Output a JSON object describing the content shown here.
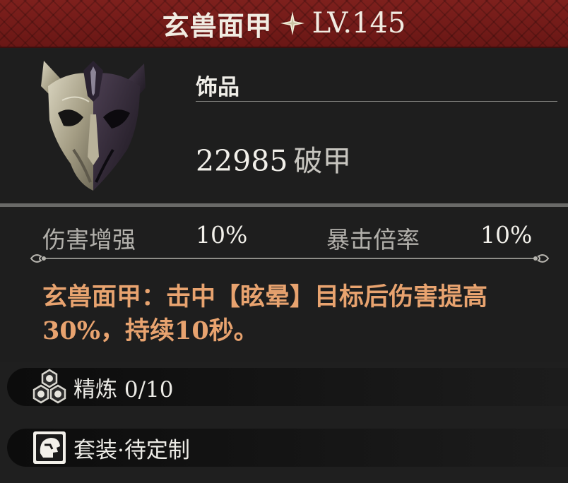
{
  "header": {
    "item_name": "玄兽面甲",
    "level": "LV.145",
    "star_icon": "four-point-star-icon"
  },
  "item": {
    "icon": "beast-mask-icon",
    "category": "饰品",
    "main_stat": {
      "value": "22985",
      "name": "破甲"
    }
  },
  "attributes": [
    {
      "name": "伤害增强",
      "value": "10%"
    },
    {
      "name": "暴击倍率",
      "value": "10%"
    }
  ],
  "effect_description": "玄兽面甲：击中【眩晕】目标后伤害提高30%，持续10秒。",
  "refine": {
    "icon": "refine-orbs-icon",
    "label": "精炼 0/10"
  },
  "set": {
    "icon": "helmet-icon",
    "label": "套装·待定制"
  },
  "colors": {
    "header_red": "#7e201d",
    "effect_text": "#e8a36f",
    "background": "#1e1e1e"
  }
}
